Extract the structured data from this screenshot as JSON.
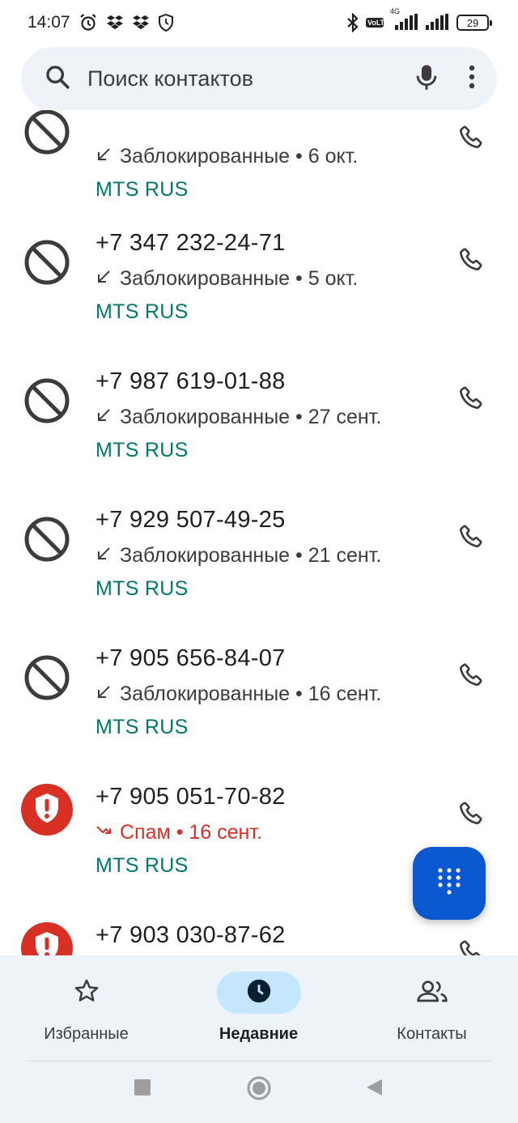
{
  "status_bar": {
    "time": "14:07",
    "volte": "VoLTE",
    "network": "4G",
    "battery": "29"
  },
  "search": {
    "placeholder": "Поиск контактов"
  },
  "calls": [
    {
      "number": "",
      "detail": "Заблокированные • 6 окт.",
      "carrier": "MTS RUS",
      "type": "blocked"
    },
    {
      "number": "+7 347 232-24-71",
      "detail": "Заблокированные • 5 окт.",
      "carrier": "MTS RUS",
      "type": "blocked"
    },
    {
      "number": "+7 987 619-01-88",
      "detail": "Заблокированные • 27 сент.",
      "carrier": "MTS RUS",
      "type": "blocked"
    },
    {
      "number": "+7 929 507-49-25",
      "detail": "Заблокированные • 21 сент.",
      "carrier": "MTS RUS",
      "type": "blocked"
    },
    {
      "number": "+7 905 656-84-07",
      "detail": "Заблокированные • 16 сент.",
      "carrier": "MTS RUS",
      "type": "blocked"
    },
    {
      "number": "+7 905 051-70-82",
      "detail": "Спам • 16 сент.",
      "carrier": "MTS RUS",
      "type": "spam"
    },
    {
      "number": "+7 903 030-87-62",
      "detail": "",
      "carrier": "",
      "type": "spam"
    }
  ],
  "nav": {
    "favorites": "Избранные",
    "recents": "Недавние",
    "contacts": "Контакты"
  },
  "colors": {
    "accent": "#0b57d0",
    "carrier": "#00796b",
    "spam": "#d93025",
    "nav_active": "#c2e7ff"
  }
}
